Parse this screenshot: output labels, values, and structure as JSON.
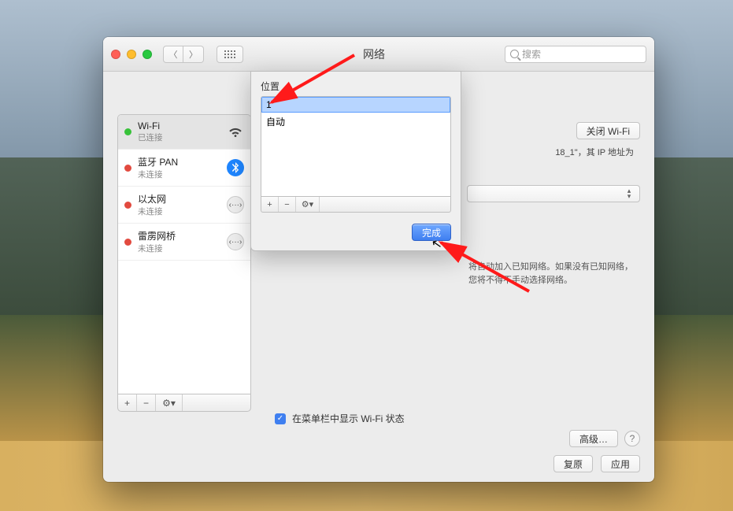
{
  "window": {
    "title": "网络",
    "search_placeholder": "搜索",
    "location_label": "位",
    "revert_button": "复原",
    "apply_button": "应用",
    "advanced_button": "高级…",
    "show_in_menubar_label": "在菜单栏中显示 Wi-Fi 状态"
  },
  "services": [
    {
      "name": "Wi-Fi",
      "status": "已连接",
      "dot": "green",
      "icon": "wifi",
      "selected": true
    },
    {
      "name": "蓝牙 PAN",
      "status": "未连接",
      "dot": "red",
      "icon": "bt",
      "selected": false
    },
    {
      "name": "以太网",
      "status": "未连接",
      "dot": "red",
      "icon": "eth",
      "selected": false
    },
    {
      "name": "雷雳网桥",
      "status": "未连接",
      "dot": "red",
      "icon": "tb",
      "selected": false
    }
  ],
  "sidebar_footer": {
    "add": "+",
    "remove": "−",
    "gear": "⚙︎▾"
  },
  "detail": {
    "turn_off_wifi": "关闭 Wi-Fi",
    "status_fragment": "18_1\"，其 IP 地址为",
    "auto_join_text": "将自动加入已知网络。如果没有已知网络，您将不得不手动选择网络。"
  },
  "sheet": {
    "label": "位置",
    "items": [
      {
        "label": "1",
        "selected": true
      },
      {
        "label": "自动",
        "selected": false
      }
    ],
    "toolbar": {
      "add": "+",
      "remove": "−",
      "gear": "⚙︎▾"
    },
    "done_button": "完成"
  }
}
